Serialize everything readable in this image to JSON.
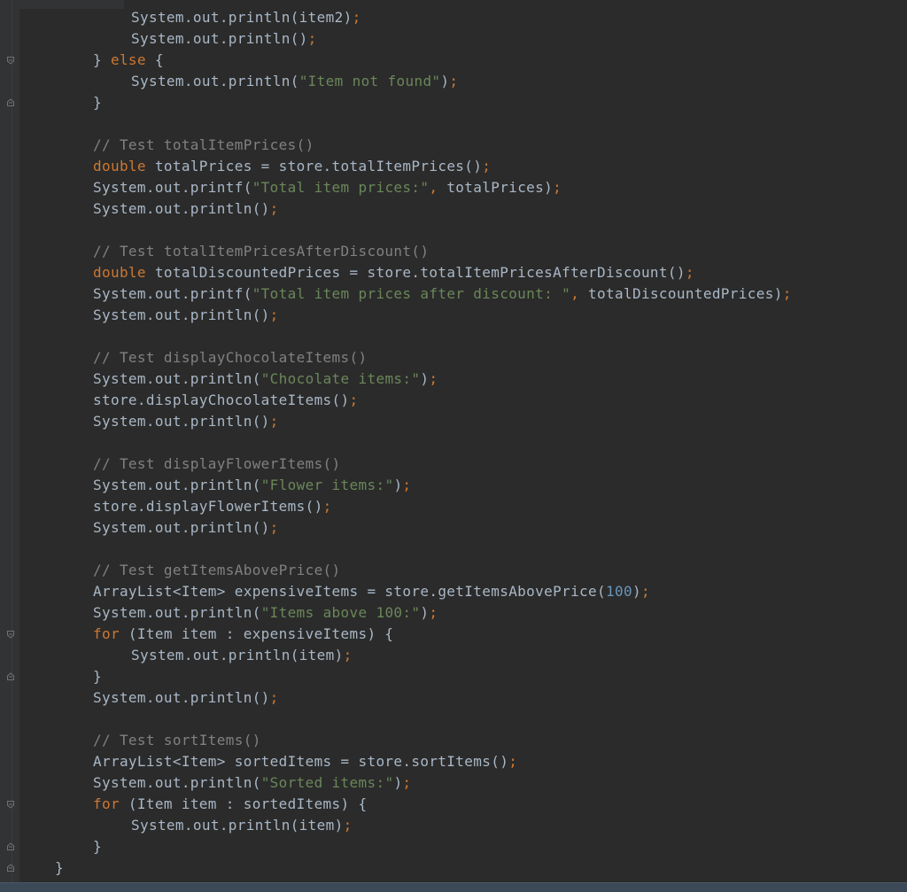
{
  "editor": {
    "lines": [
      {
        "indent": 148,
        "tokens": [
          {
            "t": "System.out.println(item2)",
            "c": "plain"
          },
          {
            "t": ";",
            "c": "kw"
          }
        ]
      },
      {
        "indent": 148,
        "tokens": [
          {
            "t": "System.out.println()",
            "c": "plain"
          },
          {
            "t": ";",
            "c": "kw"
          }
        ]
      },
      {
        "indent": 105,
        "tokens": [
          {
            "t": "} ",
            "c": "plain"
          },
          {
            "t": "else",
            "c": "kw"
          },
          {
            "t": " {",
            "c": "plain"
          }
        ]
      },
      {
        "indent": 148,
        "tokens": [
          {
            "t": "System.out.println(",
            "c": "plain"
          },
          {
            "t": "\"Item not found\"",
            "c": "str"
          },
          {
            "t": ")",
            "c": "plain"
          },
          {
            "t": ";",
            "c": "kw"
          }
        ]
      },
      {
        "indent": 105,
        "tokens": [
          {
            "t": "}",
            "c": "plain"
          }
        ]
      },
      {
        "indent": 105,
        "tokens": []
      },
      {
        "indent": 105,
        "tokens": [
          {
            "t": "// Test totalItemPrices()",
            "c": "cmt"
          }
        ]
      },
      {
        "indent": 105,
        "tokens": [
          {
            "t": "double",
            "c": "kw"
          },
          {
            "t": " totalPrices = store.totalItemPrices()",
            "c": "plain"
          },
          {
            "t": ";",
            "c": "kw"
          }
        ]
      },
      {
        "indent": 105,
        "tokens": [
          {
            "t": "System.out.printf(",
            "c": "plain"
          },
          {
            "t": "\"Total item prices:\"",
            "c": "str"
          },
          {
            "t": ",",
            "c": "kw"
          },
          {
            "t": " totalPrices)",
            "c": "plain"
          },
          {
            "t": ";",
            "c": "kw"
          }
        ]
      },
      {
        "indent": 105,
        "tokens": [
          {
            "t": "System.out.println()",
            "c": "plain"
          },
          {
            "t": ";",
            "c": "kw"
          }
        ]
      },
      {
        "indent": 105,
        "tokens": []
      },
      {
        "indent": 105,
        "tokens": [
          {
            "t": "// Test totalItemPricesAfterDiscount()",
            "c": "cmt"
          }
        ]
      },
      {
        "indent": 105,
        "tokens": [
          {
            "t": "double",
            "c": "kw"
          },
          {
            "t": " totalDiscountedPrices = store.totalItemPricesAfterDiscount()",
            "c": "plain"
          },
          {
            "t": ";",
            "c": "kw"
          }
        ]
      },
      {
        "indent": 105,
        "tokens": [
          {
            "t": "System.out.printf(",
            "c": "plain"
          },
          {
            "t": "\"Total item prices after discount: \"",
            "c": "str"
          },
          {
            "t": ",",
            "c": "kw"
          },
          {
            "t": " totalDiscountedPrices)",
            "c": "plain"
          },
          {
            "t": ";",
            "c": "kw"
          }
        ]
      },
      {
        "indent": 105,
        "tokens": [
          {
            "t": "System.out.println()",
            "c": "plain"
          },
          {
            "t": ";",
            "c": "kw"
          }
        ]
      },
      {
        "indent": 105,
        "tokens": []
      },
      {
        "indent": 105,
        "tokens": [
          {
            "t": "// Test displayChocolateItems()",
            "c": "cmt"
          }
        ]
      },
      {
        "indent": 105,
        "tokens": [
          {
            "t": "System.out.println(",
            "c": "plain"
          },
          {
            "t": "\"Chocolate items:\"",
            "c": "str"
          },
          {
            "t": ")",
            "c": "plain"
          },
          {
            "t": ";",
            "c": "kw"
          }
        ]
      },
      {
        "indent": 105,
        "tokens": [
          {
            "t": "store.displayChocolateItems()",
            "c": "plain"
          },
          {
            "t": ";",
            "c": "kw"
          }
        ]
      },
      {
        "indent": 105,
        "tokens": [
          {
            "t": "System.out.println()",
            "c": "plain"
          },
          {
            "t": ";",
            "c": "kw"
          }
        ]
      },
      {
        "indent": 105,
        "tokens": []
      },
      {
        "indent": 105,
        "tokens": [
          {
            "t": "// Test displayFlowerItems()",
            "c": "cmt"
          }
        ]
      },
      {
        "indent": 105,
        "tokens": [
          {
            "t": "System.out.println(",
            "c": "plain"
          },
          {
            "t": "\"Flower items:\"",
            "c": "str"
          },
          {
            "t": ")",
            "c": "plain"
          },
          {
            "t": ";",
            "c": "kw"
          }
        ]
      },
      {
        "indent": 105,
        "tokens": [
          {
            "t": "store.displayFlowerItems()",
            "c": "plain"
          },
          {
            "t": ";",
            "c": "kw"
          }
        ]
      },
      {
        "indent": 105,
        "tokens": [
          {
            "t": "System.out.println()",
            "c": "plain"
          },
          {
            "t": ";",
            "c": "kw"
          }
        ]
      },
      {
        "indent": 105,
        "tokens": []
      },
      {
        "indent": 105,
        "tokens": [
          {
            "t": "// Test getItemsAbovePrice()",
            "c": "cmt"
          }
        ]
      },
      {
        "indent": 105,
        "tokens": [
          {
            "t": "ArrayList<Item> expensiveItems = store.getItemsAbovePrice(",
            "c": "plain"
          },
          {
            "t": "100",
            "c": "num"
          },
          {
            "t": ")",
            "c": "plain"
          },
          {
            "t": ";",
            "c": "kw"
          }
        ]
      },
      {
        "indent": 105,
        "tokens": [
          {
            "t": "System.out.println(",
            "c": "plain"
          },
          {
            "t": "\"Items above 100:\"",
            "c": "str"
          },
          {
            "t": ")",
            "c": "plain"
          },
          {
            "t": ";",
            "c": "kw"
          }
        ]
      },
      {
        "indent": 105,
        "tokens": [
          {
            "t": "for",
            "c": "kw"
          },
          {
            "t": " (Item item : expensiveItems) {",
            "c": "plain"
          }
        ]
      },
      {
        "indent": 148,
        "tokens": [
          {
            "t": "System.out.println(item)",
            "c": "plain"
          },
          {
            "t": ";",
            "c": "kw"
          }
        ]
      },
      {
        "indent": 105,
        "tokens": [
          {
            "t": "}",
            "c": "plain"
          }
        ]
      },
      {
        "indent": 105,
        "tokens": [
          {
            "t": "System.out.println()",
            "c": "plain"
          },
          {
            "t": ";",
            "c": "kw"
          }
        ]
      },
      {
        "indent": 105,
        "tokens": []
      },
      {
        "indent": 105,
        "tokens": [
          {
            "t": "// Test sortItems()",
            "c": "cmt"
          }
        ]
      },
      {
        "indent": 105,
        "tokens": [
          {
            "t": "ArrayList<Item> sortedItems = store.sortItems()",
            "c": "plain"
          },
          {
            "t": ";",
            "c": "kw"
          }
        ]
      },
      {
        "indent": 105,
        "tokens": [
          {
            "t": "System.out.println(",
            "c": "plain"
          },
          {
            "t": "\"Sorted items:\"",
            "c": "str"
          },
          {
            "t": ")",
            "c": "plain"
          },
          {
            "t": ";",
            "c": "kw"
          }
        ]
      },
      {
        "indent": 105,
        "tokens": [
          {
            "t": "for",
            "c": "kw"
          },
          {
            "t": " (Item item : sortedItems) {",
            "c": "plain"
          }
        ]
      },
      {
        "indent": 148,
        "tokens": [
          {
            "t": "System.out.println(item)",
            "c": "plain"
          },
          {
            "t": ";",
            "c": "kw"
          }
        ]
      },
      {
        "indent": 105,
        "tokens": [
          {
            "t": "}",
            "c": "plain"
          }
        ]
      },
      {
        "indent": 62,
        "tokens": [
          {
            "t": "}",
            "c": "plain"
          }
        ]
      }
    ],
    "fold_markers": [
      {
        "line": 2,
        "kind": "open"
      },
      {
        "line": 4,
        "kind": "close"
      },
      {
        "line": 29,
        "kind": "open"
      },
      {
        "line": 31,
        "kind": "close"
      },
      {
        "line": 37,
        "kind": "open"
      },
      {
        "line": 39,
        "kind": "close"
      },
      {
        "line": 40,
        "kind": "close"
      }
    ]
  }
}
